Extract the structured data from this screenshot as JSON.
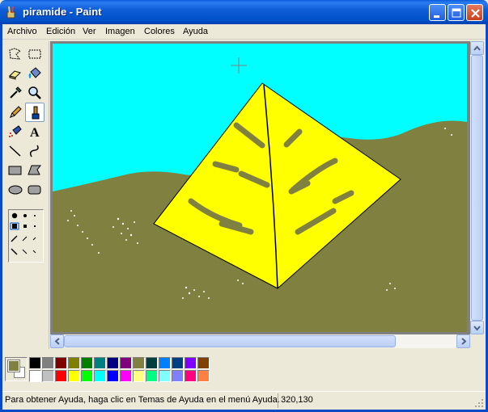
{
  "window": {
    "title": "piramide - Paint",
    "icon": "paint-brush-cup-icon"
  },
  "title_buttons": [
    "minimize-icon",
    "maximize-icon",
    "close-icon"
  ],
  "menu": {
    "items": [
      {
        "label": "Archivo"
      },
      {
        "label": "Edición"
      },
      {
        "label": "Ver"
      },
      {
        "label": "Imagen"
      },
      {
        "label": "Colores"
      },
      {
        "label": "Ayuda"
      }
    ]
  },
  "tools": [
    {
      "name": "free-select-icon"
    },
    {
      "name": "rect-select-icon"
    },
    {
      "name": "eraser-icon"
    },
    {
      "name": "fill-bucket-icon"
    },
    {
      "name": "color-picker-icon"
    },
    {
      "name": "magnifier-icon"
    },
    {
      "name": "pencil-icon"
    },
    {
      "name": "brush-icon",
      "active": true
    },
    {
      "name": "airbrush-icon"
    },
    {
      "name": "text-icon",
      "glyph": "A"
    },
    {
      "name": "line-icon"
    },
    {
      "name": "curve-icon"
    },
    {
      "name": "rectangle-icon"
    },
    {
      "name": "polygon-icon"
    },
    {
      "name": "ellipse-icon"
    },
    {
      "name": "rounded-rect-icon"
    }
  ],
  "canvas": {
    "sky_color": "#00ffff",
    "ground_color": "#808040",
    "pyramid_color": "#ffff00",
    "stroke_color": "#000000"
  },
  "palette": {
    "foreground": "#808040",
    "background": "#ffffff",
    "row1": [
      "#000000",
      "#808080",
      "#800000",
      "#808000",
      "#008000",
      "#008080",
      "#000080",
      "#800080",
      "#808040",
      "#004040",
      "#0080ff",
      "#004080",
      "#8000ff",
      "#804000"
    ],
    "row2": [
      "#ffffff",
      "#c0c0c0",
      "#ff0000",
      "#ffff00",
      "#00ff00",
      "#00ffff",
      "#0000ff",
      "#ff00ff",
      "#ffff80",
      "#00ff80",
      "#80ffff",
      "#8080ff",
      "#ff0080",
      "#ff8040"
    ]
  },
  "status": {
    "help_text": "Para obtener Ayuda, haga clic en Temas de Ayuda en el menú Ayuda.",
    "coords": "320,130"
  }
}
